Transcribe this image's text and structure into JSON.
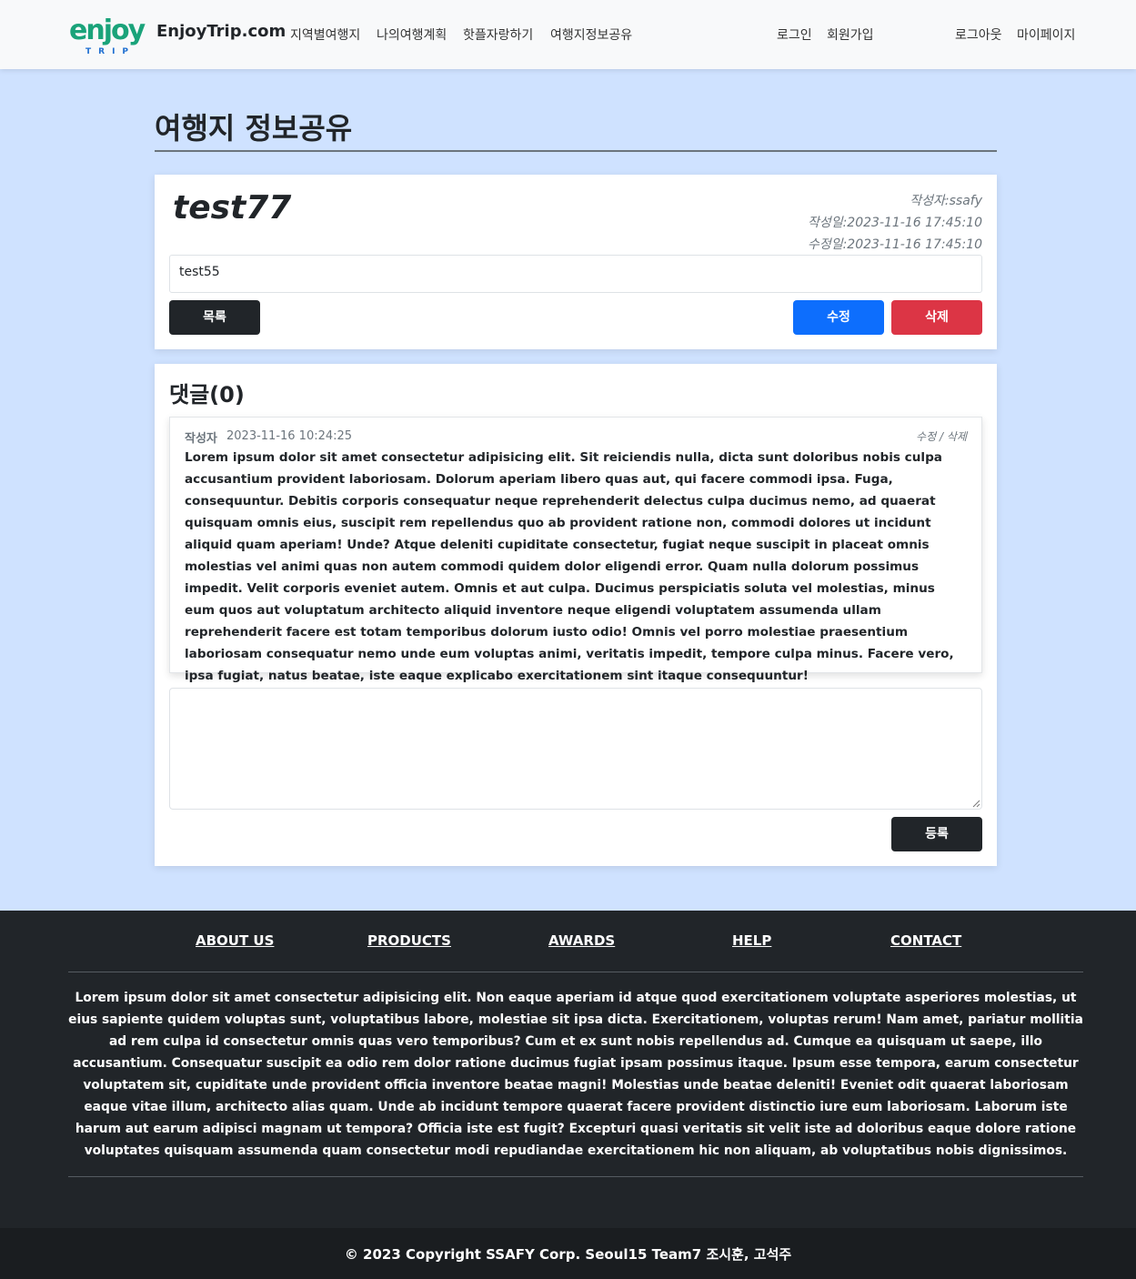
{
  "navbar": {
    "logo_main": "enjoy",
    "logo_sub": "TRIP",
    "brand": "EnjoyTrip.com",
    "links": [
      "지역별여행지",
      "나의여행계획",
      "핫플자랑하기",
      "여행지정보공유"
    ],
    "login": "로그인",
    "signup": "회원가입",
    "logout": "로그아웃",
    "mypage": "마이페이지"
  },
  "page": {
    "title": "여행지 정보공유"
  },
  "article": {
    "title": "test77",
    "author": "작성자:ssafy",
    "created": "작성일:2023-11-16 17:45:10",
    "updated": "수정일:2023-11-16 17:45:10",
    "body": "test55",
    "list_label": "목록",
    "edit_label": "수정",
    "delete_label": "삭제"
  },
  "comments": {
    "heading": "댓글(0)",
    "item": {
      "author": "작성자",
      "date": "2023-11-16 10:24:25",
      "actions": "수정 / 삭제",
      "text": "Lorem ipsum dolor sit amet consectetur adipisicing elit. Sit reiciendis nulla, dicta sunt doloribus nobis culpa accusantium provident laboriosam. Dolorum aperiam libero quas aut, qui facere commodi ipsa. Fuga, consequuntur. Debitis corporis consequatur neque reprehenderit delectus culpa ducimus nemo, ad quaerat quisquam omnis eius, suscipit rem repellendus quo ab provident ratione non, commodi dolores ut incidunt aliquid quam aperiam! Unde? Atque deleniti cupiditate consectetur, fugiat neque suscipit in placeat omnis molestias vel animi quas non autem commodi quidem dolor eligendi error. Quam nulla dolorum possimus impedit. Velit corporis eveniet autem. Omnis et aut culpa. Ducimus perspiciatis soluta vel molestias, minus eum quos aut voluptatum architecto aliquid inventore neque eligendi voluptatem assumenda ullam reprehenderit facere est totam temporibus dolorum iusto odio! Omnis vel porro molestiae praesentium laboriosam consequatur nemo unde eum voluptas animi, veritatis impedit, tempore culpa minus. Facere vero, ipsa fugiat, natus beatae, iste eaque explicabo exercitationem sint itaque consequuntur!"
    },
    "textarea_value": "",
    "submit_label": "등록"
  },
  "footer": {
    "links": [
      "ABOUT US",
      "PRODUCTS",
      "AWARDS",
      "HELP",
      "CONTACT"
    ],
    "text": "Lorem ipsum dolor sit amet consectetur adipisicing elit. Non eaque aperiam id atque quod exercitationem voluptate asperiores molestias, ut eius sapiente quidem voluptas sunt, voluptatibus labore, molestiae sit ipsa dicta. Exercitationem, voluptas rerum! Nam amet, pariatur mollitia ad rem culpa id consectetur omnis quas vero temporibus? Cum et ex sunt nobis repellendus ad. Cumque ea quisquam ut saepe, illo accusantium. Consequatur suscipit ea odio rem dolor ratione ducimus fugiat ipsam possimus itaque. Ipsum esse tempora, earum consectetur voluptatem sit, cupiditate unde provident officia inventore beatae magni! Molestias unde beatae deleniti! Eveniet odit quaerat laboriosam eaque vitae illum, architecto alias quam. Unde ab incidunt tempore quaerat facere provident distinctio iure eum laboriosam. Laborum iste harum aut earum adipisci magnam ut tempora? Officia iste est fugit? Excepturi quasi veritatis sit velit iste ad doloribus eaque dolore ratione voluptates quisquam assumenda quam consectetur modi repudiandae exercitationem hic non aliquam, ab voluptatibus nobis dignissimos.",
    "copyright": "© 2023 Copyright SSAFY Corp. Seoul15 Team7 조시훈, 고석주"
  },
  "colors": {
    "page_bg": "#cfe2ff",
    "navbar_bg": "#f8f9fa",
    "primary": "#0d6efd",
    "danger": "#dc3545",
    "dark": "#212529",
    "logo_green": "#1aa37a",
    "logo_blue": "#1f6fd1"
  }
}
